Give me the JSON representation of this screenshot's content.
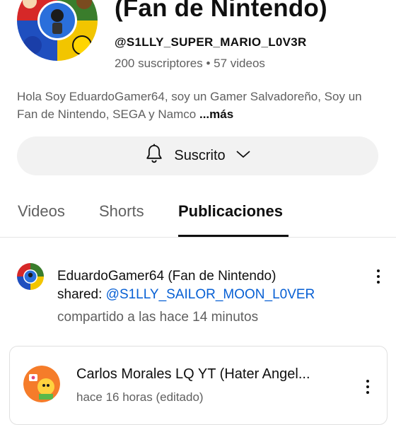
{
  "channel": {
    "name": "(Fan de Nintendo)",
    "handle": "@S1LLY_SUPER_MARIO_L0V3R",
    "subscribers": "200 suscriptores",
    "separator": " • ",
    "videos": "57 videos",
    "description": "Hola Soy EduardoGamer64, soy un Gamer Salvadoreño, Soy un Fan de Nintendo, SEGA y Namco ",
    "more_label": "...más"
  },
  "subscribe": {
    "label": "Suscrito",
    "icons": [
      "bell-icon",
      "chevron-down-icon"
    ]
  },
  "tabs": [
    {
      "label": "Videos",
      "active": false
    },
    {
      "label": "Shorts",
      "active": false
    },
    {
      "label": "Publicaciones",
      "active": true
    }
  ],
  "post": {
    "author": "EduardoGamer64 (Fan de Nintendo)",
    "shared_label": "shared: ",
    "shared_handle": "@S1LLY_SAILOR_MOON_L0VER",
    "time": "compartido a las hace 14 minutos"
  },
  "shared_card": {
    "author": "Carlos Morales LQ YT (Hater Angel...",
    "meta": "hace 16 horas (editado)"
  },
  "colors": {
    "link": "#065fd4",
    "secondary_text": "#606060",
    "pill_bg": "#f2f2f2"
  }
}
